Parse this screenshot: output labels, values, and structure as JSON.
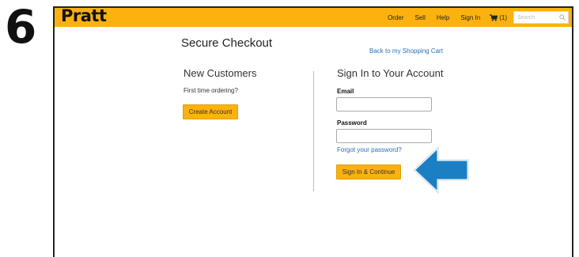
{
  "step_number": "6",
  "header": {
    "logo": "Pratt",
    "nav": [
      "Order",
      "Sell",
      "Help",
      "Sign In"
    ],
    "cart_count": "(1)",
    "search_placeholder": "Search"
  },
  "checkout": {
    "title": "Secure Checkout",
    "back_link": "Back to my Shopping Cart",
    "new_customers": {
      "heading": "New Customers",
      "subtext": "First time ordering?",
      "button": "Create Account"
    },
    "sign_in": {
      "heading": "Sign In to Your Account",
      "email_label": "Email",
      "email_value": "",
      "password_label": "Password",
      "password_value": "",
      "forgot_link": "Forgot your password?",
      "button": "Sign In & Continue"
    }
  },
  "colors": {
    "brand_yellow": "#fbb20f",
    "link_blue": "#2a6fb8",
    "annotation_arrow": "#1b7fc4"
  },
  "icons": [
    "cart-icon",
    "search-icon",
    "pointer-arrow-icon"
  ]
}
